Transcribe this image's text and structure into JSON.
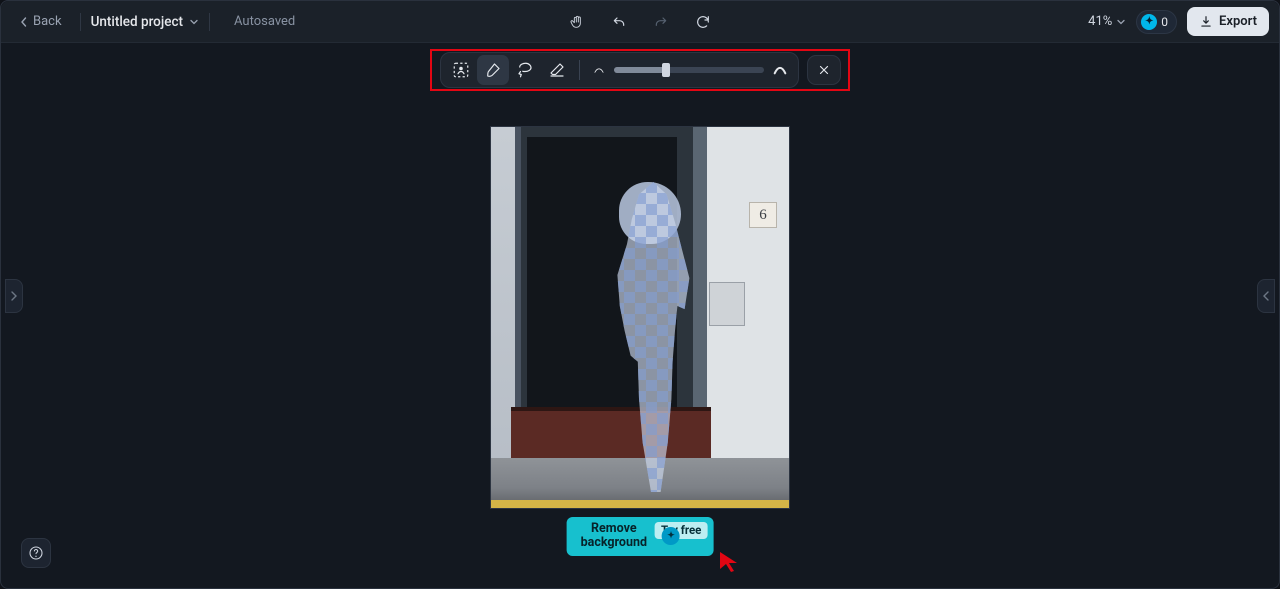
{
  "topbar": {
    "back_label": "Back",
    "project_title": "Untitled project",
    "autosaved_label": "Autosaved",
    "zoom_pct": "41%",
    "credits": "0",
    "export_label": "Export"
  },
  "toolbar": {
    "tools": [
      "subject-detect",
      "brush",
      "lasso",
      "eraser"
    ],
    "active_tool": "brush",
    "brush_size_pct": 35
  },
  "canvas": {
    "house_number": "6"
  },
  "pill": {
    "line1": "Remove",
    "line2": "background",
    "badge": "Try free"
  }
}
